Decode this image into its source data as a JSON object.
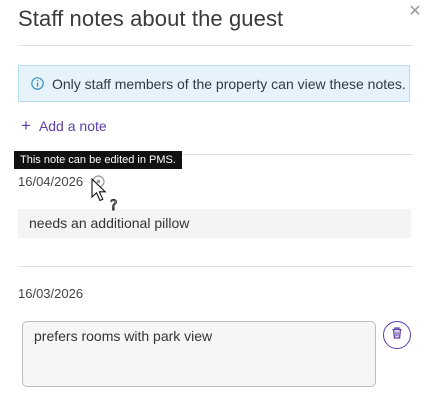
{
  "dialog": {
    "title": "Staff notes about the guest",
    "close_icon": "close-icon",
    "info_text": "Only staff members of the property can view these notes.",
    "add_note_label": "Add a note"
  },
  "tooltip": {
    "text": "This note can be edited in PMS."
  },
  "notes": [
    {
      "date": "16/04/2026",
      "text": "needs an additional pillow",
      "editable": false
    },
    {
      "date": "16/03/2026",
      "text": "prefers rooms with park view",
      "editable": true
    }
  ],
  "colors": {
    "accent": "#5b3fa8",
    "info_bg": "#e6f3fb",
    "info_border": "#b9dcee",
    "info_icon": "#3a8fc4"
  }
}
